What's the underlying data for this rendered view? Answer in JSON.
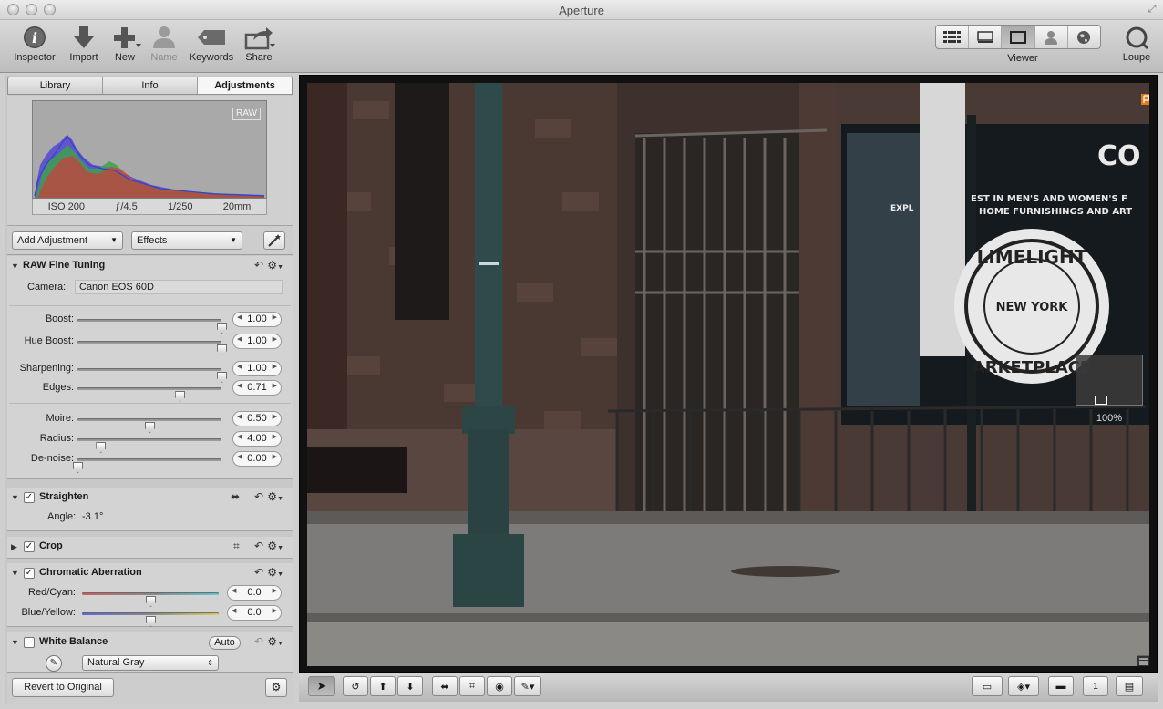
{
  "window": {
    "title": "Aperture"
  },
  "toolbar": {
    "inspector": "Inspector",
    "import": "Import",
    "new": "New",
    "name": "Name",
    "keywords": "Keywords",
    "share": "Share",
    "viewer": "Viewer",
    "loupe": "Loupe"
  },
  "tabs": {
    "library": "Library",
    "info": "Info",
    "adjustments": "Adjustments"
  },
  "histogram": {
    "badge": "RAW",
    "iso": "ISO 200",
    "aperture": "ƒ/4.5",
    "shutter": "1/250",
    "focal": "20mm"
  },
  "adjust_bar": {
    "add_adjustment": "Add Adjustment",
    "effects": "Effects"
  },
  "raw_fine_tuning": {
    "title": "RAW Fine Tuning",
    "camera_label": "Camera:",
    "camera_value": "Canon EOS 60D",
    "sliders": [
      {
        "label": "Boost:",
        "value": "1.00",
        "level": 1.0
      },
      {
        "label": "Hue Boost:",
        "value": "1.00",
        "level": 1.0
      },
      {
        "label": "Sharpening:",
        "value": "1.00",
        "level": 1.0
      },
      {
        "label": "Edges:",
        "value": "0.71",
        "level": 0.71
      },
      {
        "label": "Moire:",
        "value": "0.50",
        "level": 0.5
      },
      {
        "label": "Radius:",
        "value": "4.00",
        "level": 0.16
      },
      {
        "label": "De-noise:",
        "value": "0.00",
        "level": 0.0
      }
    ]
  },
  "straighten": {
    "title": "Straighten",
    "angle_label": "Angle:",
    "angle_value": "-3.1°"
  },
  "crop": {
    "title": "Crop"
  },
  "chromatic_aberration": {
    "title": "Chromatic Aberration",
    "red_cyan_label": "Red/Cyan:",
    "red_cyan_value": "0.0",
    "blue_yellow_label": "Blue/Yellow:",
    "blue_yellow_value": "0.0"
  },
  "white_balance": {
    "title": "White Balance",
    "auto": "Auto",
    "mode": "Natural Gray"
  },
  "bottom": {
    "revert": "Revert to Original"
  },
  "viewer_overlay": {
    "zoom": "100%"
  },
  "photo_text": {
    "sign_top": "CO IN",
    "sign_sub1": "EST IN MEN'S AND WOMEN'S F",
    "sign_sub2": "HOME FURNISHINGS AND ART",
    "expl": "EXPL",
    "limelight": "LIMELIGHT",
    "new_york": "NEW YORK",
    "marketplace": "ARKETPLACE"
  }
}
